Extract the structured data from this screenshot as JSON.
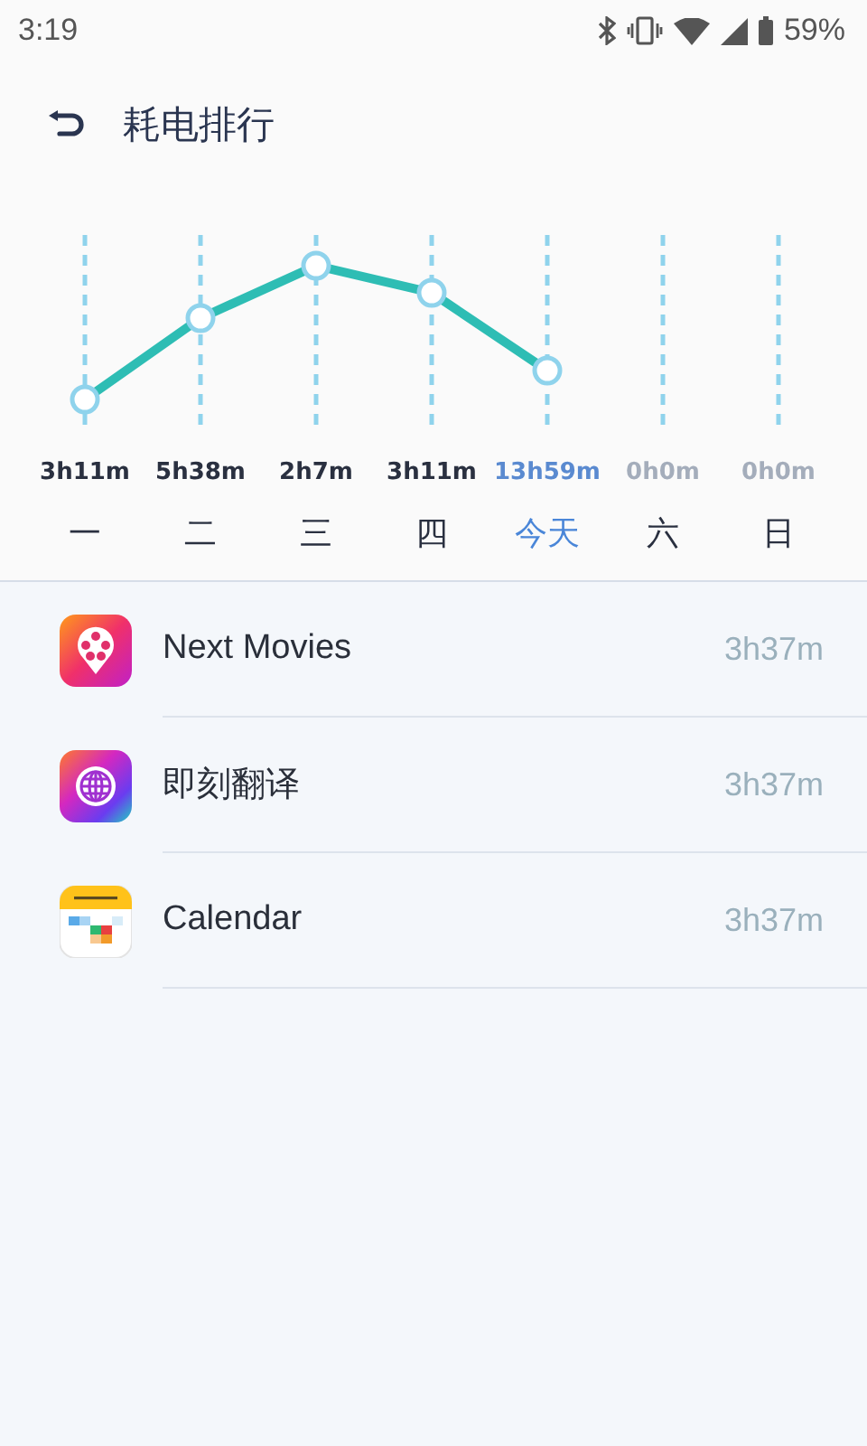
{
  "status_bar": {
    "time": "3:19",
    "battery": "59%"
  },
  "header": {
    "title": "耗电排行"
  },
  "days": [
    {
      "value": "3h11m",
      "label": "一",
      "selected": false,
      "empty": false
    },
    {
      "value": "5h38m",
      "label": "二",
      "selected": false,
      "empty": false
    },
    {
      "value": "2h7m",
      "label": "三",
      "selected": false,
      "empty": false
    },
    {
      "value": "3h11m",
      "label": "四",
      "selected": false,
      "empty": false
    },
    {
      "value": "13h59m",
      "label": "今天",
      "selected": true,
      "empty": false
    },
    {
      "value": "0h0m",
      "label": "六",
      "selected": false,
      "empty": true
    },
    {
      "value": "0h0m",
      "label": "日",
      "selected": false,
      "empty": true
    }
  ],
  "apps": [
    {
      "name": "Next Movies",
      "time": "3h37m",
      "kind": "movies"
    },
    {
      "name": "即刻翻译",
      "time": "3h37m",
      "kind": "translate"
    },
    {
      "name": "Calendar",
      "time": "3h37m",
      "kind": "calendar"
    }
  ]
}
